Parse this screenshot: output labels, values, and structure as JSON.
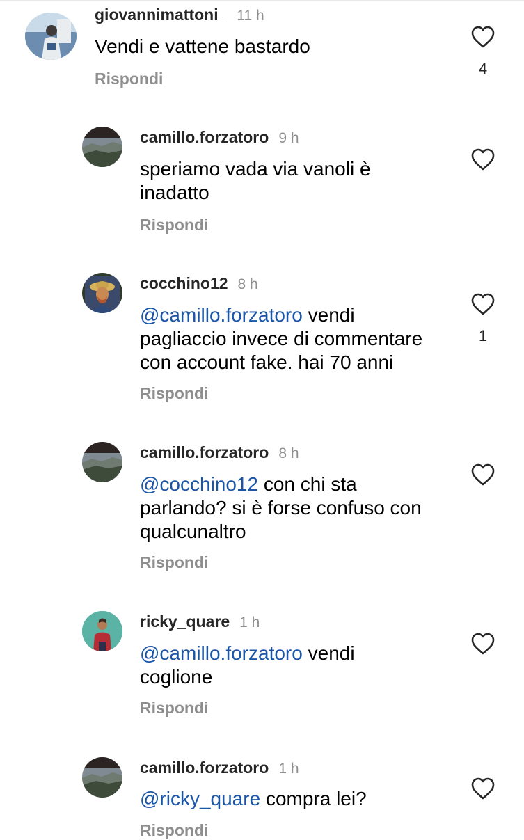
{
  "comments": [
    {
      "username": "giovannimattoni_",
      "time": "11 h",
      "mention": "",
      "text": "Vendi e vattene bastardo",
      "reply_label": "Rispondi",
      "likes": "4"
    },
    {
      "username": "camillo.forzatoro",
      "time": "9 h",
      "mention": "",
      "text": "speriamo vada via vanoli è inadatto",
      "reply_label": "Rispondi",
      "likes": ""
    },
    {
      "username": "cocchino12",
      "time": "8 h",
      "mention": "@camillo.forzatoro",
      "text": "vendi pagliaccio invece di commentare con account fake. hai 70 anni",
      "reply_label": "Rispondi",
      "likes": "1"
    },
    {
      "username": "camillo.forzatoro",
      "time": "8 h",
      "mention": "@cocchino12",
      "text": "con chi sta parlando? si è forse confuso con qualcunaltro",
      "reply_label": "Rispondi",
      "likes": ""
    },
    {
      "username": "ricky_quare",
      "time": "1 h",
      "mention": "@camillo.forzatoro",
      "text": "vendi coglione",
      "reply_label": "Rispondi",
      "likes": ""
    },
    {
      "username": "camillo.forzatoro",
      "time": "1 h",
      "mention": "@ricky_quare",
      "text": "compra lei?",
      "reply_label": "Rispondi",
      "likes": ""
    }
  ],
  "colors": {
    "mention": "#1a56a8",
    "secondary_text": "#8e8e8e"
  },
  "icons": {
    "like": "heart-outline-icon"
  }
}
